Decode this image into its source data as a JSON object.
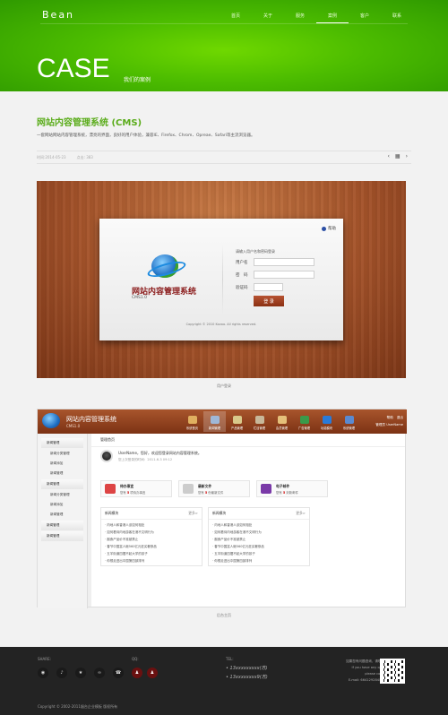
{
  "brand": {
    "logo": "Bean",
    "accent": "#5aac1a"
  },
  "nav": [
    {
      "label": "首页",
      "active": false
    },
    {
      "label": "关于",
      "active": false
    },
    {
      "label": "服务",
      "active": false
    },
    {
      "label": "案例",
      "active": true
    },
    {
      "label": "客户",
      "active": false
    },
    {
      "label": "联系",
      "active": false
    }
  ],
  "hero": {
    "title": "CASE",
    "subtitle": "我们的案例"
  },
  "article": {
    "title": "网站内容管理系统 (CMS)",
    "description": "一套网站网站内容管理系统，漂亮的界面，良好的用户体验，兼容IE、Firefox、Chrom、Opreae、Safari等主流浏览器。",
    "date": "时间:2014-05-23",
    "views": "点击: 383",
    "pager": {
      "prev": "‹",
      "grid": "▦",
      "next": "›"
    }
  },
  "login_shot": {
    "help": "帮助",
    "system_name": "网站内容管理系统",
    "version": "CMS1.0",
    "prompt": "请输入用户名和密码登录",
    "username_label": "用户名",
    "password_label": "密　码",
    "captcha_label": "验证码",
    "login_button": "登 录",
    "copyright": "Copyright © 2010 Kovoo. All rights reserved.",
    "caption": "用户登录"
  },
  "admin_shot": {
    "system_name": "网站内容管理系统",
    "version": "CMS1.0",
    "tools": [
      {
        "label": "系统首页",
        "icon": "home-icon",
        "color": "#e0b060",
        "active": false
      },
      {
        "label": "新闻管理",
        "icon": "news-icon",
        "color": "#9fb8d8",
        "active": true
      },
      {
        "label": "产品管理",
        "icon": "product-icon",
        "color": "#d9c98a",
        "active": false
      },
      {
        "label": "栏目管理",
        "icon": "column-icon",
        "color": "#c8b89a",
        "active": false
      },
      {
        "label": "会员管理",
        "icon": "member-icon",
        "color": "#e5c07a",
        "active": false
      },
      {
        "label": "广告管理",
        "icon": "ad-icon",
        "color": "#3a9a4a",
        "active": false
      },
      {
        "label": "功能模块",
        "icon": "module-icon",
        "color": "#2a7ad8",
        "active": false
      },
      {
        "label": "系统管理",
        "icon": "system-icon",
        "color": "#5a8ad0",
        "active": false
      }
    ],
    "help": "帮助",
    "logout": "退出",
    "admin_user": "管理员 UserName",
    "sidebar": [
      {
        "group": "新闻管理",
        "items": [
          "新闻分类管理",
          "新闻添加",
          "新闻管理"
        ]
      },
      {
        "group": "新闻管理",
        "items": [
          "新闻分类管理",
          "新闻添加",
          "新闻管理"
        ]
      },
      {
        "group": "新闻管理",
        "items": []
      },
      {
        "group": "新闻管理",
        "items": []
      }
    ],
    "breadcrumb": "管理首页",
    "welcome": "UserName，您好，欢迎您登录网站内容管理系统。",
    "last_login": "您上次登录的时间：2011-6-3 09:12",
    "cards": [
      {
        "title": "待办事宜",
        "pre": "您有",
        "count": "5",
        "post": "项待办事宜",
        "color": "#d44"
      },
      {
        "title": "最新文件",
        "pre": "您有",
        "count": "5",
        "post": "份最新文件",
        "color": "#ccc"
      },
      {
        "title": "电子邮件",
        "pre": "您有",
        "count": "5",
        "post": "封新邮件",
        "color": "#7a3aa8"
      }
    ],
    "boxes": [
      {
        "title": "新闻模块",
        "more": "更多>",
        "items": [
          "内地人和香港人该如何相处",
          "如何看待内地游客在港不文明行为",
          "副食产品价不准被禁止",
          "春节中国富人砸560亿元狂买奢侈品",
          "五羊街道四摆不起大学的孩子",
          "你想走进出中国第四部排列"
        ]
      },
      {
        "title": "新闻模块",
        "more": "更多>",
        "items": [
          "内地人和香港人该如何相处",
          "如何看待内地游客在港不文明行为",
          "副食产品价不准被禁止",
          "春节中国富人砸560亿元狂买奢侈品",
          "五羊街道四摆不起大学的孩子",
          "你想走进出中国第四部排列"
        ]
      }
    ],
    "caption": "后台主页"
  },
  "footer": {
    "share_label": "SHARE:",
    "share_icons": [
      {
        "name": "weibo-icon",
        "glyph": "◉"
      },
      {
        "name": "qzone-icon",
        "glyph": "♪"
      },
      {
        "name": "favorite-icon",
        "glyph": "★"
      },
      {
        "name": "renren-icon",
        "glyph": "∞"
      },
      {
        "name": "douban-icon",
        "glyph": "☎"
      }
    ],
    "qq_label": "QQ:",
    "tel_label": "TEL:",
    "tels": [
      "13xxxxxxxxx(苏)",
      "13xxxxxxxx9(苏)"
    ],
    "contact_cn": "如果您有问题咨询，请联系我们！",
    "contact_en1": "If you have any questions,",
    "contact_en2": "please contact us.",
    "email": "E-mail: 664129284@qq.com",
    "copyright": "Copyright © 2002-2011烟台企业模板 版权所有"
  }
}
